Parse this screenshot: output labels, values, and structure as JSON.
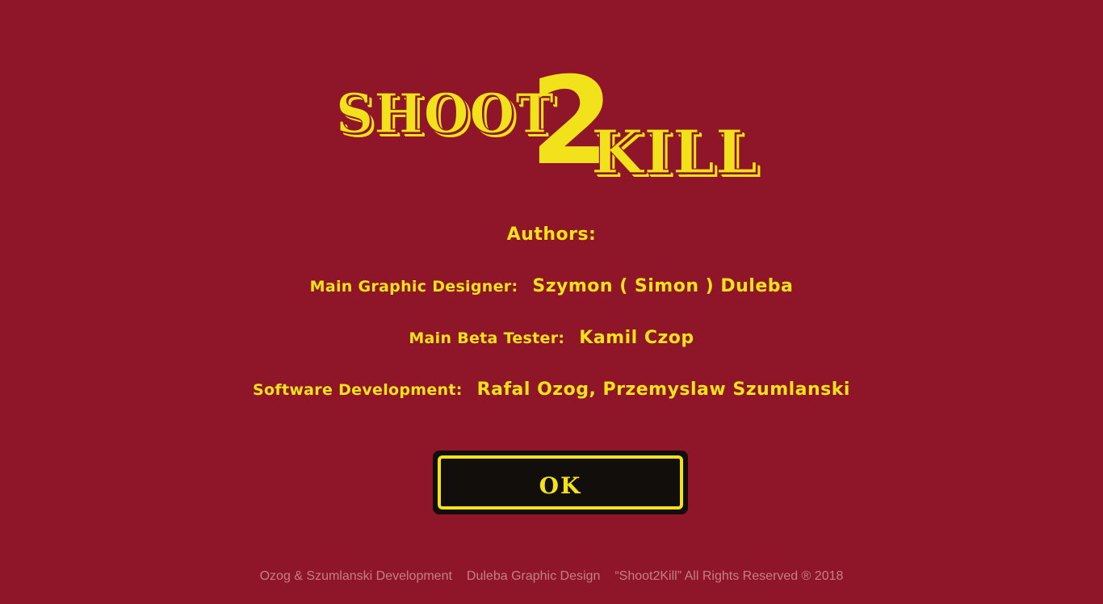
{
  "colors": {
    "background": "#8e1628",
    "accent": "#f2e21b",
    "button_fill": "#120e0c",
    "footer_text": "#c77f87"
  },
  "logo": {
    "word_1": "SHOOT",
    "number": "2",
    "word_2": "KILL"
  },
  "credits": {
    "heading": "Authors:",
    "graphic_designer": {
      "role": "Main Graphic Designer:",
      "name": "Szymon  ( Simon ) Duleba"
    },
    "beta_tester": {
      "role": "Main Beta Tester:",
      "name": "Kamil Czop"
    },
    "software_development": {
      "role": "Software Development:",
      "name": "Rafal Ozog, Przemyslaw Szumlanski"
    }
  },
  "ok_button": {
    "label": "OK"
  },
  "footer": {
    "developer": "Ozog & Szumlanski Development",
    "designer": "Duleba Graphic Design",
    "copyright": "“Shoot2Kill” All Rights Reserved ® 2018"
  }
}
